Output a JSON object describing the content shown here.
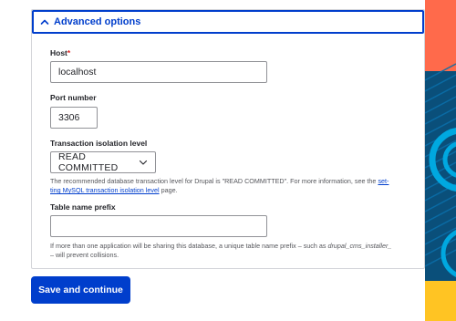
{
  "details": {
    "summary_label": "Advanced options"
  },
  "host": {
    "label": "Host",
    "required_marker": "*",
    "value": "localhost"
  },
  "port": {
    "label": "Port number",
    "value": "3306"
  },
  "isolation": {
    "label": "Transaction isolation level",
    "selected": "READ COMMITTED",
    "desc_part1": "The recommended database transaction level for Drupal is \"READ COMMITTED\". For more information, see the ",
    "desc_link_line1": "set-",
    "desc_link_line2": "ting MySQL transaction isolation level",
    "desc_part2": " page."
  },
  "prefix": {
    "label": "Table name prefix",
    "value": "",
    "desc_part1": "If more than one application will be sharing this database, a unique table name prefix – such as ",
    "desc_code": "drupal_cms_installer_",
    "desc_part2": " – will prevent collisions."
  },
  "actions": {
    "submit_label": "Save and continue"
  },
  "colors": {
    "primary": "#003ecc",
    "deco_orange": "#ff6a4b",
    "deco_blue": "#0a6ea8",
    "deco_cyan": "#00a8e0",
    "deco_yellow": "#ffc423"
  },
  "icons": {
    "summary": "chevron-up-icon",
    "select": "chevron-down-icon"
  }
}
